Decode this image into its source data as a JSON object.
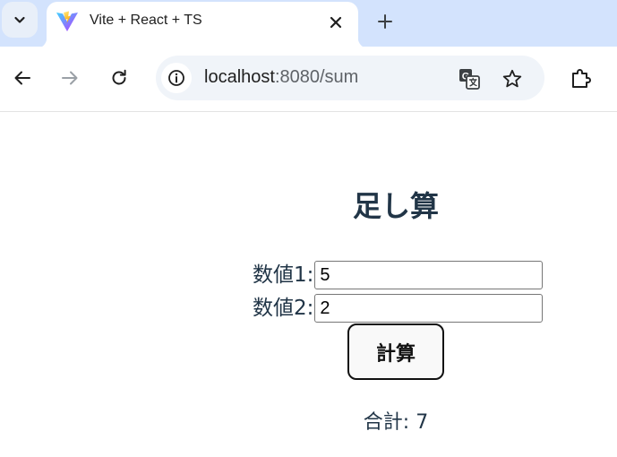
{
  "browser": {
    "tab": {
      "title": "Vite + React + TS",
      "favicon": "vite-logo-icon"
    },
    "address_bar": {
      "host": "localhost",
      "path": ":8080/sum"
    },
    "icons": {
      "tab_search": "chevron-down-icon",
      "tab_close": "close-icon",
      "new_tab": "plus-icon",
      "back": "arrow-left-icon",
      "forward": "arrow-right-icon",
      "reload": "reload-icon",
      "site_info": "info-icon",
      "translate": "translate-icon",
      "bookmark": "star-icon",
      "extensions": "puzzle-icon"
    },
    "colors": {
      "tabstrip": "#d3e3fd",
      "omnibox": "#f0f4f9",
      "text": "#213547"
    }
  },
  "page": {
    "heading": "足し算",
    "fields": [
      {
        "label": "数値1:",
        "value": "5"
      },
      {
        "label": "数値2:",
        "value": "2"
      }
    ],
    "button_label": "計算",
    "result_text": "合計: 7"
  }
}
